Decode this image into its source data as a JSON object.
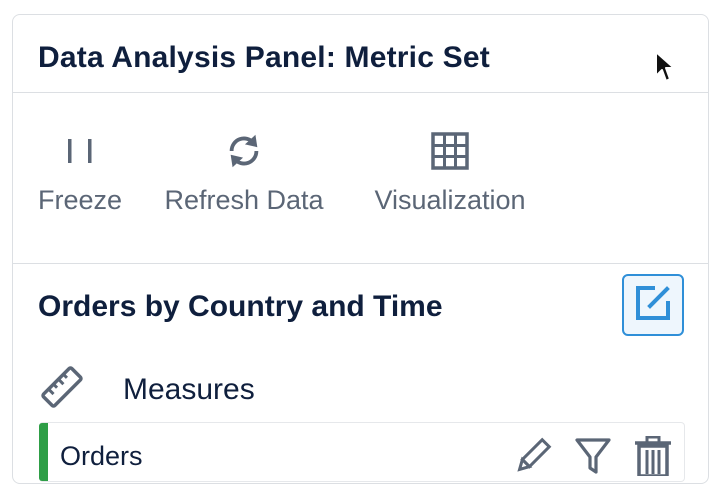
{
  "panel": {
    "title": "Data Analysis Panel: Metric Set"
  },
  "toolbar": {
    "items": [
      {
        "label": "Freeze",
        "icon": "pause-icon"
      },
      {
        "label": "Refresh Data",
        "icon": "refresh-icon"
      },
      {
        "label": "Visualization",
        "icon": "grid-icon"
      }
    ]
  },
  "section": {
    "title": "Orders by Country and Time",
    "edit_icon": "edit-icon",
    "measures": {
      "label": "Measures",
      "icon": "ruler-icon",
      "items": [
        {
          "label": "Orders",
          "accent_color": "#2e9e46",
          "actions": [
            "pencil-icon",
            "filter-icon",
            "trash-icon"
          ]
        }
      ]
    }
  },
  "colors": {
    "title_text": "#0f1f3d",
    "toolbar_text": "#5b6676",
    "accent_blue": "#2f8fd8",
    "measure_green": "#2e9e46",
    "border": "#dcdfe3"
  }
}
